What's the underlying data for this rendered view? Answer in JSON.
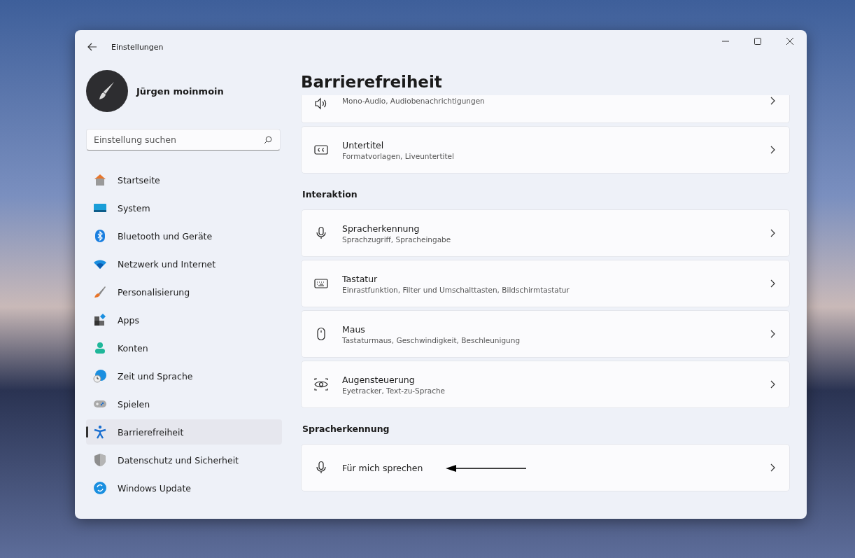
{
  "window": {
    "title": "Einstellungen"
  },
  "user": {
    "name": "Jürgen moinmoin"
  },
  "search": {
    "placeholder": "Einstellung suchen"
  },
  "sidebar": {
    "items": [
      {
        "label": "Startseite",
        "kind": "home",
        "selected": false
      },
      {
        "label": "System",
        "kind": "system",
        "selected": false
      },
      {
        "label": "Bluetooth und Geräte",
        "kind": "bluetooth",
        "selected": false
      },
      {
        "label": "Netzwerk und Internet",
        "kind": "wifi",
        "selected": false
      },
      {
        "label": "Personalisierung",
        "kind": "brush",
        "selected": false
      },
      {
        "label": "Apps",
        "kind": "apps",
        "selected": false
      },
      {
        "label": "Konten",
        "kind": "person",
        "selected": false
      },
      {
        "label": "Zeit und Sprache",
        "kind": "globe",
        "selected": false
      },
      {
        "label": "Spielen",
        "kind": "gamepad",
        "selected": false
      },
      {
        "label": "Barrierefreiheit",
        "kind": "access",
        "selected": true
      },
      {
        "label": "Datenschutz und Sicherheit",
        "kind": "shield",
        "selected": false
      },
      {
        "label": "Windows Update",
        "kind": "update",
        "selected": false
      }
    ]
  },
  "page": {
    "title": "Barrierefreiheit",
    "sections": [
      {
        "items": [
          {
            "kind": "speaker",
            "subtitle": "Mono-Audio, Audiobenachrichtigungen",
            "cut": true
          },
          {
            "kind": "cc",
            "title": "Untertitel",
            "subtitle": "Formatvorlagen, Liveuntertitel"
          }
        ]
      },
      {
        "heading": "Interaktion",
        "items": [
          {
            "kind": "mic",
            "title": "Spracherkennung",
            "subtitle": "Sprachzugriff, Spracheingabe"
          },
          {
            "kind": "keyboard",
            "title": "Tastatur",
            "subtitle": "Einrastfunktion, Filter und Umschalttasten, Bildschirmtastatur"
          },
          {
            "kind": "mouse",
            "title": "Maus",
            "subtitle": "Tastaturmaus, Geschwindigkeit, Beschleunigung"
          },
          {
            "kind": "eye",
            "title": "Augensteuerung",
            "subtitle": "Eyetracker, Text-zu-Sprache"
          }
        ]
      },
      {
        "heading": "Spracherkennung",
        "items": [
          {
            "kind": "mic",
            "title": "Für mich sprechen",
            "arrow": true
          }
        ]
      }
    ]
  }
}
